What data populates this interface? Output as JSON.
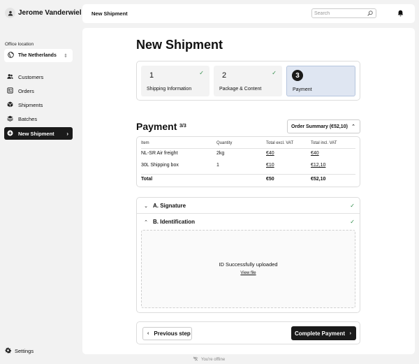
{
  "user": {
    "name": "Jerome Vanderwiel"
  },
  "office": {
    "label": "Office location",
    "value": "The Netherlands"
  },
  "nav": {
    "items": [
      {
        "label": "Customers"
      },
      {
        "label": "Orders"
      },
      {
        "label": "Shipments"
      },
      {
        "label": "Batches"
      }
    ],
    "active": {
      "label": "New Shipment"
    }
  },
  "settings": {
    "label": "Settings"
  },
  "topbar": {
    "title": "New Shipment",
    "search_placeholder": "Search"
  },
  "page": {
    "title": "New Shipment"
  },
  "steps": [
    {
      "number": "1",
      "label": "Shipping Information",
      "state": "completed"
    },
    {
      "number": "2",
      "label": "Package & Content",
      "state": "completed"
    },
    {
      "number": "3",
      "label": "Payment",
      "state": "current"
    }
  ],
  "payment": {
    "title": "Payment",
    "count": "3/3",
    "order_summary": "Order Summary (€52,10)"
  },
  "table": {
    "headers": [
      "Item",
      "Quantity",
      "Total excl. VAT",
      "Total incl. VAT"
    ],
    "rows": [
      {
        "item": "NL-SR Air freight",
        "quantity": "2kg",
        "excl": "€40",
        "incl": "€40"
      },
      {
        "item": "30L Shipping box",
        "quantity": "1",
        "excl": "€10",
        "incl": "€12,10"
      }
    ],
    "total": {
      "label": "Total",
      "excl": "€50",
      "incl": "€52,10"
    }
  },
  "sections": {
    "signature": {
      "label": "A. Signature",
      "state": "completed"
    },
    "identification": {
      "label": "B. Identification",
      "state": "completed"
    }
  },
  "upload": {
    "message": "ID Successfully uploaded",
    "link": "View file"
  },
  "actions": {
    "previous": "Previous step",
    "complete": "Complete Payment"
  },
  "status": {
    "offline": "You're offline"
  },
  "colors": {
    "accent": "#1a1a1a",
    "success": "#2d8a47",
    "current_step_bg": "#dfe6f2",
    "panel_bg": "#f2f2f2"
  }
}
